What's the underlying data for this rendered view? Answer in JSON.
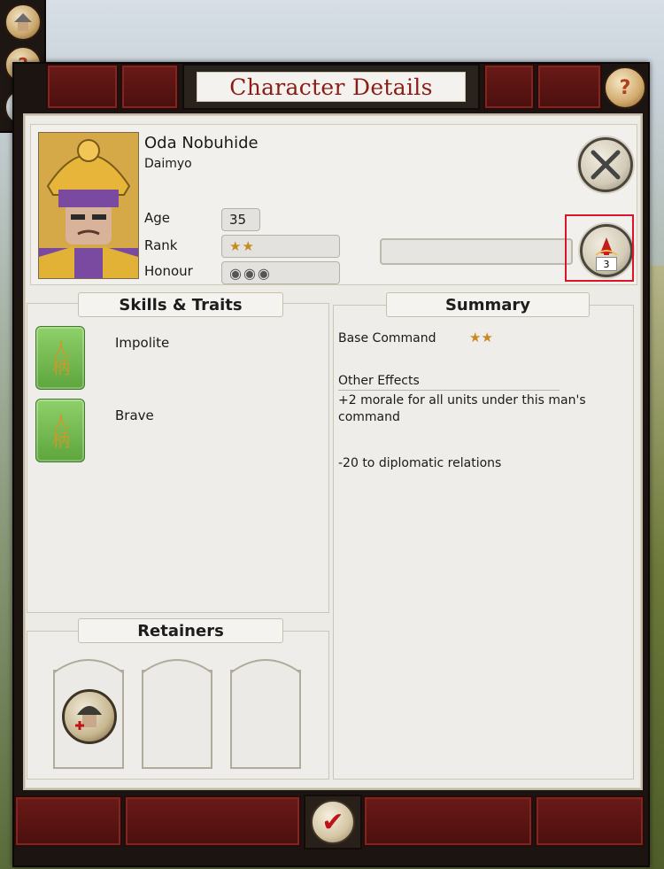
{
  "header": {
    "title": "Character Details"
  },
  "character": {
    "name": "Oda Nobuhide",
    "title": "Daimyo",
    "stats": [
      {
        "label": "Age",
        "value": "35"
      },
      {
        "label": "Rank",
        "value": "★★"
      },
      {
        "label": "Honour",
        "value": "◉◉◉"
      }
    ],
    "skill_points": "3"
  },
  "skills": {
    "heading": "Skills & Traits",
    "traits": [
      {
        "label": "Impolite",
        "glyph": "人柄"
      },
      {
        "label": "Brave",
        "glyph": "人柄"
      }
    ]
  },
  "summary": {
    "heading": "Summary",
    "base_command_label": "Base Command",
    "base_command_stars": "★★",
    "other_effects_label": "Other Effects",
    "effects": [
      "+2 morale for all units under this man's command",
      "-20 to diplomatic relations"
    ]
  },
  "retainers": {
    "heading": "Retainers"
  },
  "icons": {
    "help": "?",
    "confirm": "✔"
  },
  "colors": {
    "title_red": "#8a1d17",
    "highlight": "#d9152a",
    "trait_green": "#5da53c"
  }
}
